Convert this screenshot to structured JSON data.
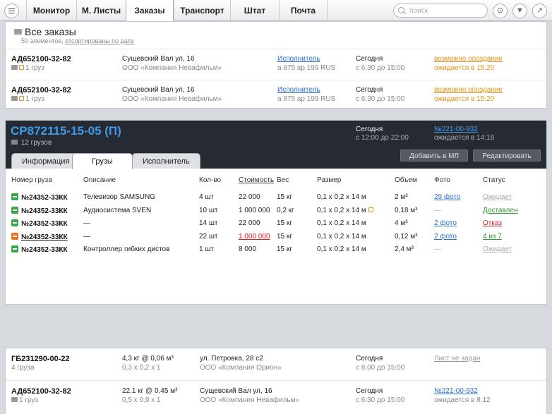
{
  "nav": {
    "tabs": [
      {
        "label": "Монитор"
      },
      {
        "label": "М. Листы"
      },
      {
        "label": "Заказы"
      },
      {
        "label": "Транспорт"
      },
      {
        "label": "Штат"
      },
      {
        "label": "Почта"
      }
    ],
    "active_tab": "Заказы",
    "search_placeholder": "поиск",
    "icons": [
      "menu-icon",
      "search-icon",
      "paperclip-icon",
      "filter-icon",
      "expand-icon"
    ]
  },
  "orders_panel": {
    "title": "Все заказы",
    "count_text": "50 элементов,",
    "sort_link": "отсортированы по дате",
    "rows": [
      {
        "id": "АД652100-32-82",
        "cargo": "1 груз",
        "address": "Сущевский Вал ул, 16",
        "company": "ООО «Компания Невафильм»",
        "executor_link": "Исполнитель",
        "executor_detail": "а 875 ар 199 RUS",
        "day": "Сегодня",
        "time": "с 6:30 до 15:00",
        "status": "возможно опоздание",
        "status_detail": "ожидается в 15:20"
      },
      {
        "id": "АД652100-32-82",
        "cargo": "1 груз",
        "address": "Сущевский Вал ул, 16",
        "company": "ООО «Компания Невафильм»",
        "executor_link": "Исполнитель",
        "executor_detail": "а 875 ар 199 RUS",
        "day": "Сегодня",
        "time": "с 6:30 до 15:00",
        "status": "возможно опоздание",
        "status_detail": "ожидается в 15:20"
      }
    ]
  },
  "detail": {
    "id": "СР872115-15-05 (П)",
    "cargo_count": "12 грузов",
    "day": "Сегодня",
    "time": "с 12:00 до 22:00",
    "route_link": "№221-00-932",
    "expected": "ожидается в 14:18",
    "tabs": [
      "Информация",
      "Грузы",
      "Исполнитель"
    ],
    "active_tab": "Грузы",
    "add_button": "Добавить в МЛ",
    "edit_button": "Редактировать",
    "columns": [
      "Номер груза",
      "Описание",
      "Кол-во",
      "Стоимость",
      "Вес",
      "Размер",
      "Объем",
      "Фото",
      "Статус"
    ],
    "rows": [
      {
        "num": "№24352-33КК",
        "desc": "Телевизор SAMSUNG",
        "qty": "4 шт",
        "cost": "22 000",
        "weight": "15 кг",
        "size": "0,1 x 0,2 x 14 м",
        "volume": "2 м³",
        "photo": "29 фото",
        "status": "Ожидает",
        "box_color": "#3aa54a",
        "status_color": "#aaaaaa"
      },
      {
        "num": "№24352-33КК",
        "desc": "Аудиосистема SVEN",
        "qty": "10 шт",
        "cost": "1 000 000",
        "weight": "0,2 кг",
        "size": "0,1 x 0,2 x 14 м",
        "volume": "0,18 м³",
        "photo": "—",
        "status": "Доставлен",
        "box_color": "#3aa54a",
        "status_color": "#2c9a2c"
      },
      {
        "num": "№24352-33КК",
        "desc": "—",
        "qty": "14 шт",
        "cost": "22 000",
        "weight": "15 кг",
        "size": "0,1 x 0,2 x 14 м",
        "volume": "4 м³",
        "photo": "2 фото",
        "status": "Отказ",
        "box_color": "#3aa54a",
        "status_color": "#e02020"
      },
      {
        "num": "№24352-33КК",
        "desc": "—",
        "qty": "22 шт",
        "cost": "1 000 000",
        "weight": "15 кг",
        "size": "0,1 x 0,2 x 14 м",
        "volume": "0,12 м³",
        "photo": "2 фото",
        "status": "4 из 7",
        "box_color": "#e6731e",
        "status_color": "#2c9a2c"
      },
      {
        "num": "№24352-33КК",
        "desc": "Контроллер гибких дистов",
        "qty": "1 шт",
        "cost": "8 000",
        "weight": "15 кг",
        "size": "0,1 x 0,2 x 14 м",
        "volume": "2,4 м³",
        "photo": "—",
        "status": "Ожидает",
        "box_color": "#3aa54a",
        "status_color": "#aaaaaa"
      }
    ]
  },
  "bottom_rows": [
    {
      "id": "ГБ231290-00-22",
      "cargo": "4 груза",
      "weight": "4,3 кг @ 0,06 м³",
      "dims": "0,3 x 0,2 x 1",
      "address": "ул. Петровка, 28 с2",
      "company": "ООО «Компания Орион»",
      "day": "Сегодня",
      "time": "с 8:00 до 15:00",
      "link": "Лист не задан",
      "link_detail": ""
    },
    {
      "id": "АД652100-32-82",
      "cargo": "1 груз",
      "weight": "22,1 кг @ 0,45 м³",
      "dims": "0,5 x 0,9 x 1",
      "address": "Сущевский Вал ул, 16",
      "company": "ООО «Компания Невафильм»",
      "day": "Сегодня",
      "time": "с 6:30 до 15:00",
      "link": "№221-00-932",
      "link_detail": "ожидается в 8:12"
    }
  ]
}
